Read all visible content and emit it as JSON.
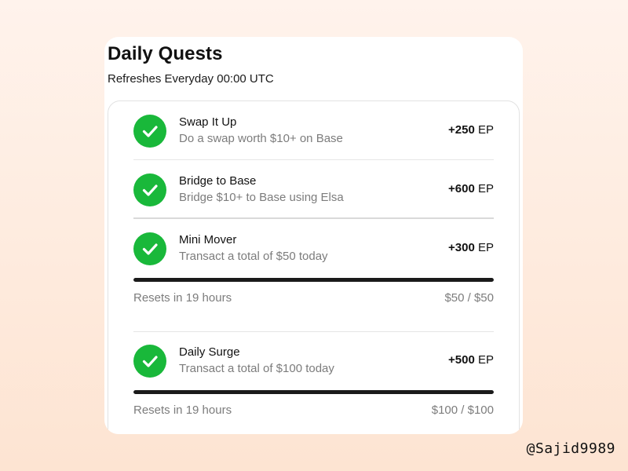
{
  "card": {
    "title": "Daily Quests",
    "subtitle": "Refreshes Everyday 00:00 UTC"
  },
  "quests": [
    {
      "title": "Swap It Up",
      "description": "Do a swap worth $10+ on Base",
      "points": "+250",
      "unit": "EP",
      "completed": true,
      "icon": "check-icon"
    },
    {
      "title": "Bridge to Base",
      "description": "Bridge $10+ to Base using Elsa",
      "points": "+600",
      "unit": "EP",
      "completed": true,
      "icon": "check-icon"
    },
    {
      "title": "Mini Mover",
      "description": "Transact a total of $50 today",
      "points": "+300",
      "unit": "EP",
      "completed": true,
      "icon": "check-icon",
      "reset_text": "Resets in 19 hours",
      "progress_text": "$50 / $50",
      "progress_fraction": 1.0
    },
    {
      "title": "Daily Surge",
      "description": "Transact a total of $100 today",
      "points": "+500",
      "unit": "EP",
      "completed": true,
      "icon": "check-icon",
      "reset_text": "Resets in 19 hours",
      "progress_text": "$100 / $100",
      "progress_fraction": 1.0
    }
  ],
  "watermark": "@Sajid9989",
  "colors": {
    "check_green": "#19b83a",
    "progress_fill": "#1a1a1a",
    "muted_text": "#7c7c7c",
    "background_top": "#fff3ec",
    "background_bottom": "#fde4d2"
  }
}
